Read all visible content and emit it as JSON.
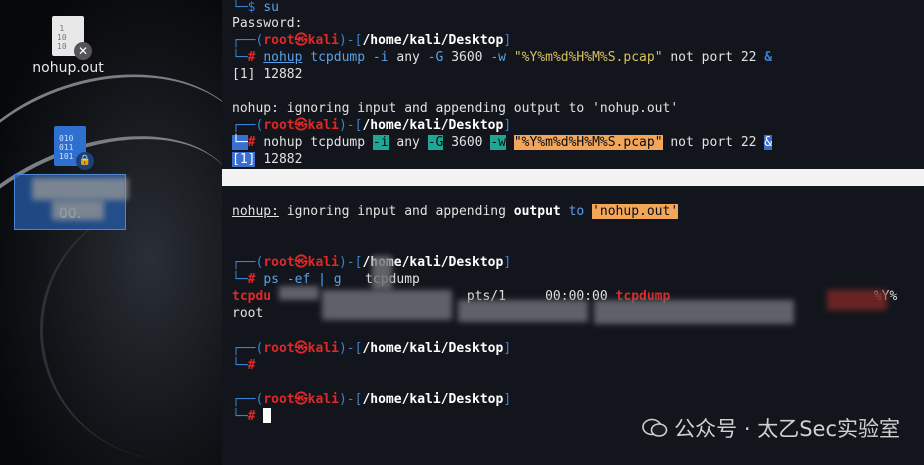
{
  "desktop": {
    "icons": [
      {
        "label": "nohup.out",
        "badge": "✕"
      },
      {
        "label": "00.",
        "badge": "🔒"
      }
    ]
  },
  "terminal": {
    "lines": {
      "l1_prompt": "└─$ ",
      "l1_cmd": "su",
      "l2": "Password:",
      "p_head_1": "┌──(",
      "user": "root",
      "at": "㉿",
      "host": "kali",
      "p_head_2": ")-[",
      "path": "/home/kali/Desktop",
      "p_head_3": "]",
      "p_tail": "└─",
      "hash": "#",
      "cmd_nohup": "nohup",
      "cmd_tcpdump": "tcpdump",
      "arg_i": "-i",
      "arg_any": "any",
      "arg_G": "-G",
      "arg_3600": "3600",
      "arg_w": "-w",
      "arg_fmt": "\"%Y%m%d%H%M%S.pcap\"",
      "arg_not": "not",
      "arg_port": "port",
      "arg_22": "22",
      "amp": "&",
      "job": "[1]",
      "job_pid": "12882",
      "nohup_msg_1": "nohup:",
      "nohup_msg_2": "ignoring input and appending",
      "nohup_msg_out": "output",
      "nohup_msg_to": "to",
      "nohup_msg_file": "'nohup.out'",
      "ps_cmd": "ps",
      "ps_args": "-ef",
      "pipe": "|",
      "grep": "g",
      "grep_arg": "tcpdump",
      "ps_row1_a": "tcpdu",
      "ps_row1_time": "pts/1",
      "ps_row1_cpu": "00:00:00",
      "ps_row1_cmd": "tcpdump",
      "ps_row1_tail": "%Y%",
      "ps_row2_user": "root"
    }
  },
  "watermark": {
    "text": "公众号 · 太乙Sec实验室"
  }
}
